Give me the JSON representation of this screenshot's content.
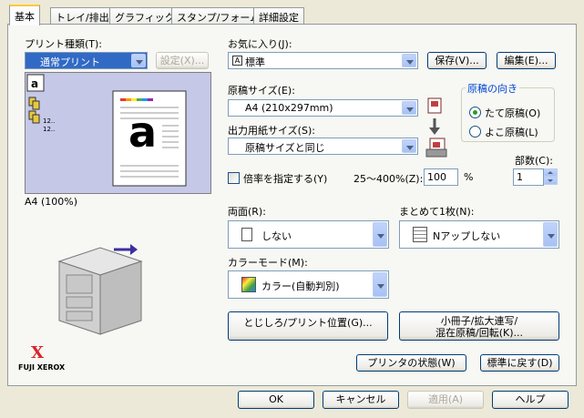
{
  "tabs": [
    "基本",
    "トレイ/排出",
    "グラフィックス",
    "スタンプ/フォーム",
    "詳細設定"
  ],
  "print_type": {
    "label": "プリント種類(T):",
    "value": "通常プリント",
    "settings_button": "設定(X)..."
  },
  "preview": {
    "paper_caption": "A4 (100%)",
    "glyph": "a",
    "small_label_1": "12..",
    "small_label_2": "12.."
  },
  "favorites": {
    "label": "お気に入り(J):",
    "value": "標準",
    "save_button": "保存(V)...",
    "edit_button": "編集(E)..."
  },
  "original_size": {
    "label": "原稿サイズ(E):",
    "value": "A4 (210x297mm)"
  },
  "output_size": {
    "label": "出力用紙サイズ(S):",
    "value": "原稿サイズと同じ"
  },
  "orientation": {
    "title": "原稿の向き",
    "portrait": "たて原稿(O)",
    "landscape": "よこ原稿(L)",
    "selected": "portrait"
  },
  "scale": {
    "label": "倍率を指定する(Y)",
    "range_label": "25～400%(Z):",
    "value": "100",
    "unit": "%"
  },
  "copies": {
    "label": "部数(C):",
    "value": "1"
  },
  "duplex": {
    "label": "両面(R):",
    "value": "しない"
  },
  "nup": {
    "label": "まとめて1枚(N):",
    "value": "Nアップしない"
  },
  "color_mode": {
    "label": "カラーモード(M):",
    "value": "カラー(自動判別)"
  },
  "buttons": {
    "binding": "とじしろ/プリント位置(G)...",
    "booklet_line1": "小冊子/拡大連写/",
    "booklet_line2": "混在原稿/回転(K)...",
    "printer_status": "プリンタの状態(W)",
    "defaults": "標準に戻す(D)",
    "ok": "OK",
    "cancel": "キャンセル",
    "apply": "適用(A)",
    "help": "ヘルプ"
  },
  "logo": {
    "mark": "X",
    "text": "FUJI XEROX"
  },
  "colors": {
    "accent_red": "#D8242A",
    "selection_blue": "#316AC5",
    "preview_bg": "#C6C8E8"
  }
}
